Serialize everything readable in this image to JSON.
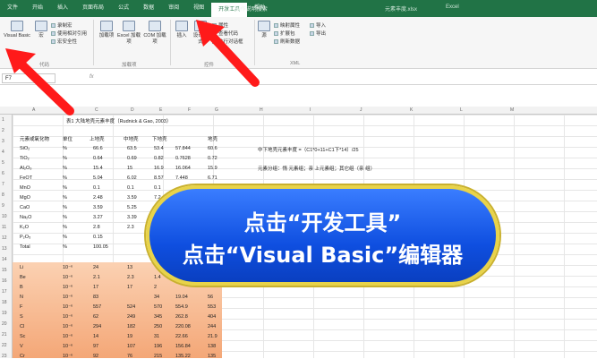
{
  "titlebar": {
    "tabs": [
      "文件",
      "开始",
      "插入",
      "页面布局",
      "公式",
      "数据",
      "审阅",
      "视图",
      "开发工具",
      "帮助"
    ],
    "active_index": 8,
    "tell_me": "操作说明搜索",
    "doc_name": "元素丰度.xlsx",
    "app_name": "Excel"
  },
  "ribbon": {
    "code": {
      "visual_basic": "Visual Basic",
      "macros": "宏",
      "record_macro": "录制宏",
      "relative_ref": "使用相对引用",
      "macro_security": "宏安全性",
      "group": "代码"
    },
    "addins": {
      "addins": "加载项",
      "excel_addins": "Excel 加载项",
      "com_addins": "COM 加载项",
      "group": "加载项"
    },
    "controls": {
      "insert": "插入",
      "design_mode": "设计模式",
      "properties": "属性",
      "view_code": "查看代码",
      "run_dialog": "执行对话框",
      "group": "控件"
    },
    "xml": {
      "source": "源",
      "map_props": "映射属性",
      "expansion": "扩展包",
      "refresh": "刷新数据",
      "import": "导入",
      "export": "导出",
      "group": "XML"
    }
  },
  "formula_bar": {
    "name_box": "F7",
    "fx": "fx"
  },
  "columns": [
    "A",
    "B",
    "C",
    "D",
    "E",
    "F",
    "G",
    "H",
    "I",
    "J",
    "K",
    "L",
    "M"
  ],
  "sheet": {
    "title": "表1 大陆地壳元素丰度（Rudnick & Gao, 2003）",
    "headers": [
      "元素或氧化物",
      "单位",
      "上地壳",
      "中地壳",
      "下地壳",
      "地壳"
    ],
    "top_rows": [
      [
        "SiO₂",
        "%",
        "66.6",
        "63.5",
        "53.4",
        "57.844",
        "60.6"
      ],
      [
        "TiO₂",
        "%",
        "0.64",
        "0.69",
        "0.82",
        "0.7628",
        "0.72"
      ],
      [
        "Al₂O₃",
        "%",
        "15.4",
        "15",
        "16.9",
        "16.064",
        "15.9"
      ],
      [
        "FeOT",
        "%",
        "5.04",
        "6.02",
        "8.57",
        "7.448",
        "6.71"
      ],
      [
        "MnO",
        "%",
        "0.1",
        "0.1",
        "0.1",
        "",
        "0.1"
      ],
      [
        "MgO",
        "%",
        "2.48",
        "3.59",
        "7.2",
        "",
        ""
      ],
      [
        "CaO",
        "%",
        "3.59",
        "5.25",
        "",
        "",
        ""
      ],
      [
        "Na₂O",
        "%",
        "3.27",
        "3.39",
        "",
        "",
        ""
      ],
      [
        "K₂O",
        "%",
        "2.8",
        "2.3",
        "",
        "",
        ""
      ],
      [
        "P₂O₅",
        "%",
        "0.15",
        "",
        "",
        "",
        ""
      ],
      [
        "Total",
        "%",
        "100.05",
        "",
        "",
        "",
        ""
      ]
    ],
    "bottom_rows": [
      [
        "Li",
        "10⁻⁶",
        "24",
        "13",
        "",
        "",
        ""
      ],
      [
        "Be",
        "10⁻⁶",
        "2.1",
        "2.3",
        "1.4",
        "",
        ""
      ],
      [
        "B",
        "10⁻⁶",
        "17",
        "17",
        "2",
        "",
        ""
      ],
      [
        "N",
        "10⁻⁶",
        "83",
        "",
        "34",
        "19.04",
        "56"
      ],
      [
        "F",
        "10⁻⁶",
        "557",
        "524",
        "570",
        "554.9",
        "553"
      ],
      [
        "S",
        "10⁻⁶",
        "62",
        "249",
        "345",
        "262.8",
        "404"
      ],
      [
        "Cl",
        "10⁻⁶",
        "294",
        "182",
        "250",
        "220.08",
        "244"
      ],
      [
        "Sc",
        "10⁻⁶",
        "14",
        "19",
        "31",
        "22.66",
        "21.9"
      ],
      [
        "V",
        "10⁻⁶",
        "97",
        "107",
        "196",
        "156.84",
        "138"
      ],
      [
        "Cr",
        "10⁻⁶",
        "92",
        "76",
        "215",
        "135.22",
        "135"
      ]
    ],
    "note1": "中下地壳元素丰度 =（C1*0+11+C1下*14）/25",
    "note2": "元素分组：惰 元素组；亲 上元素组；其它组（亲 组）"
  },
  "banner": {
    "line1": "点击“开发工具”",
    "line2": "点击“Visual Basic”编辑器"
  },
  "colors": {
    "excel_green": "#217346",
    "banner_blue": "#1557f0",
    "banner_border": "#e8d34a",
    "arrow_red": "#ff1a1a",
    "highlight_orange": "#f7b98f"
  }
}
